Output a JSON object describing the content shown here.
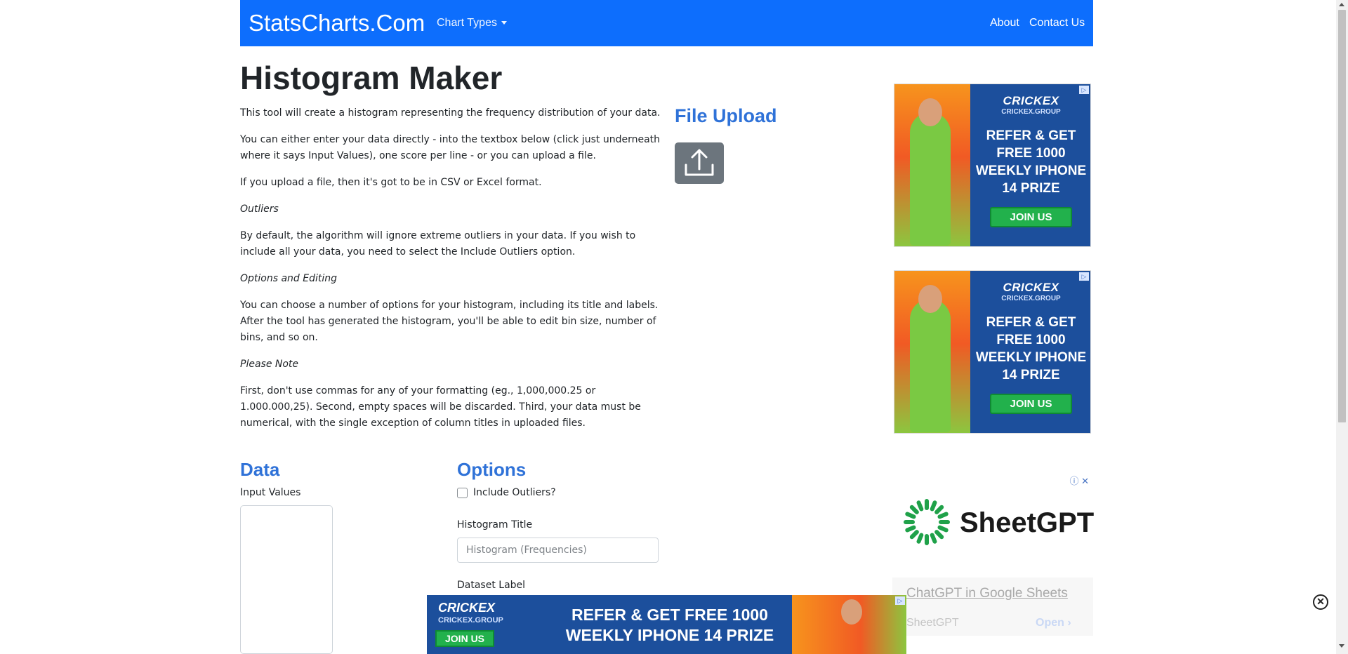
{
  "navbar": {
    "brand": "StatsCharts.Com",
    "chart_types": "Chart Types",
    "about": "About",
    "contact": "Contact Us"
  },
  "page": {
    "title": "Histogram Maker",
    "p1": "This tool will create a histogram representing the frequency distribution of your data.",
    "p2": "You can either enter your data directly - into the textbox below (click just underneath where it says Input Values), one score per line - or you can upload a file.",
    "p3": "If you upload a file, then it's got to be in CSV or Excel format.",
    "h_outliers": "Outliers",
    "p4": "By default, the algorithm will ignore extreme outliers in your data. If you wish to include all your data, you need to select the Include Outliers option.",
    "h_options": "Options and Editing",
    "p5": "You can choose a number of options for your histogram, including its title and labels. After the tool has generated the histogram, you'll be able to edit bin size, number of bins, and so on.",
    "h_note": "Please Note",
    "p6": "First, don't use commas for any of your formatting (eg., 1,000,000.25 or 1.000.000,25). Second, empty spaces will be discarded. Third, your data must be numerical, with the single exception of column titles in uploaded files."
  },
  "file_upload": {
    "title": "File Upload",
    "icon": "upload-icon"
  },
  "data_section": {
    "title": "Data",
    "input_label": "Input Values",
    "input_value": ""
  },
  "options": {
    "title": "Options",
    "include_outliers_label": "Include Outliers?",
    "include_outliers_checked": false,
    "histogram_title_label": "Histogram Title",
    "histogram_title_placeholder": "Histogram (Frequencies)",
    "histogram_title_value": "",
    "dataset_label": "Dataset Label"
  },
  "ads": {
    "crickex": {
      "brand": "CRICKEX",
      "sub": "CRICKEX.GROUP",
      "message": "REFER & GET FREE 1000 WEEKLY IPHONE 14 PRIZE",
      "cta": "JOIN US",
      "info_icon": "ad-info-icon"
    },
    "sheetgpt": {
      "logo": "SheetGPT",
      "headline": "ChatGPT in Google Sheets",
      "advertiser": "SheetGPT",
      "cta": "Open",
      "icons": "ⓘ ✕"
    },
    "banner": {
      "brand": "CRICKEX",
      "sub": "CRICKEX.GROUP",
      "cta": "JOIN US",
      "message": "REFER & GET FREE 1000 WEEKLY IPHONE 14 PRIZE"
    }
  },
  "colors": {
    "navbar": "#0d6efd",
    "section_heading": "#2f72d8",
    "upload_button": "#6c757d",
    "ad_blue": "#1c4f9c",
    "ad_green": "#22b14c"
  }
}
